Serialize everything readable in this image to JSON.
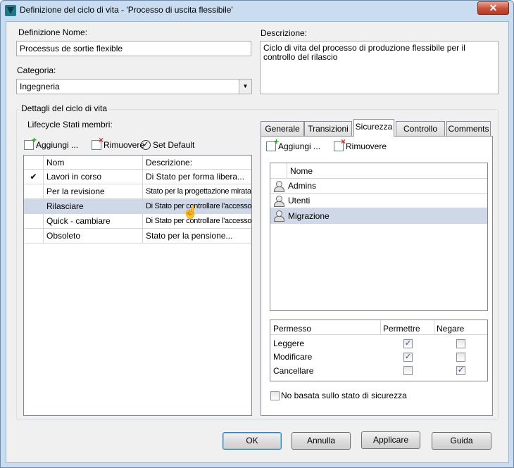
{
  "window": {
    "title": "Definizione del ciclo di vita - 'Processo di uscita flessibile'",
    "close_glyph": "✕"
  },
  "form": {
    "name_label": "Definizione Nome:",
    "name_value": "Processus de sortie flexible",
    "category_label": "Categoria:",
    "category_value": "Ingegneria",
    "description_label": "Descrizione:",
    "description_value": "Ciclo di vita del processo di produzione flessibile per il controllo del rilascio"
  },
  "details": {
    "group_label": "Dettagli del ciclo di vita",
    "states_label": "Lifecycle Stati membri:",
    "toolbar": {
      "add": "Aggiungi ...",
      "remove": "Rimuovere",
      "set_default": "Set Default"
    },
    "columns": {
      "name": "Nom",
      "description": "Descrizione:"
    },
    "states": [
      {
        "default_mark": "✔",
        "name": "Lavori in corso",
        "description": "Di Stato per forma libera..."
      },
      {
        "default_mark": "",
        "name": "Per la revisione",
        "description": "Stato per la progettazione mirata"
      },
      {
        "default_mark": "",
        "name": "Rilasciare",
        "description": "Di Stato per controllare l'accesso"
      },
      {
        "default_mark": "",
        "name": "Quick - cambiare",
        "description": "Di Stato per controllare l'accesso"
      },
      {
        "default_mark": "",
        "name": "Obsoleto",
        "description": "Stato per la pensione..."
      }
    ],
    "selected_state": "Rilasciare"
  },
  "tabs": [
    "Generale",
    "Transizioni",
    "Sicurezza",
    "Controllo",
    "Comments"
  ],
  "active_tab": "Sicurezza",
  "security": {
    "toolbar": {
      "add": "Aggiungi ...",
      "remove": "Rimuovere"
    },
    "users_column": "Nome",
    "users": [
      "Admins",
      "Utenti",
      "Migrazione"
    ],
    "selected_user": "Migrazione",
    "perm_columns": {
      "permission": "Permesso",
      "allow": "Permettre",
      "deny": "Negare"
    },
    "permissions": [
      {
        "name": "Leggere",
        "allow": true,
        "deny": false
      },
      {
        "name": "Modificare",
        "allow": true,
        "deny": false
      },
      {
        "name": "Cancellare",
        "allow": false,
        "deny": true
      }
    ],
    "no_state_security_label": "No basata sullo stato di sicurezza",
    "no_state_security_checked": false
  },
  "buttons": {
    "ok": "OK",
    "cancel": "Annulla",
    "apply": "Applicare",
    "help": "Guida"
  }
}
